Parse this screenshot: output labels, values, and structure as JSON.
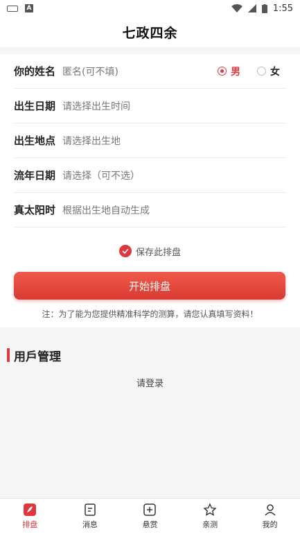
{
  "status_bar": {
    "time": "1:55"
  },
  "header": {
    "title": "七政四余"
  },
  "form": {
    "name": {
      "label": "你的姓名",
      "placeholder": "匿名(可不填)"
    },
    "gender": {
      "male": "男",
      "female": "女",
      "selected": "male"
    },
    "birth_date": {
      "label": "出生日期",
      "placeholder": "请选择出生时间"
    },
    "birth_place": {
      "label": "出生地点",
      "placeholder": "请选择出生地"
    },
    "flow_year": {
      "label": "流年日期",
      "placeholder": "请选择（可不选）"
    },
    "solar_time": {
      "label": "真太阳时",
      "placeholder": "根据出生地自动生成"
    },
    "save_label": "保存此排盘",
    "start_label": "开始排盘",
    "note": "注：为了能为您提供精准科学的测算，请您认真填写资料！"
  },
  "user_section": {
    "title": "用戶管理",
    "login_text": "请登录"
  },
  "tabbar": {
    "items": [
      {
        "label": "排盘",
        "icon": "feather-icon",
        "active": true
      },
      {
        "label": "消息",
        "icon": "document-icon",
        "active": false
      },
      {
        "label": "悬赏",
        "icon": "plus-box-icon",
        "active": false
      },
      {
        "label": "亲测",
        "icon": "star-icon",
        "active": false
      },
      {
        "label": "我的",
        "icon": "user-icon",
        "active": false
      }
    ]
  },
  "colors": {
    "accent": "#e0373c",
    "background": "#f6f6f6"
  }
}
